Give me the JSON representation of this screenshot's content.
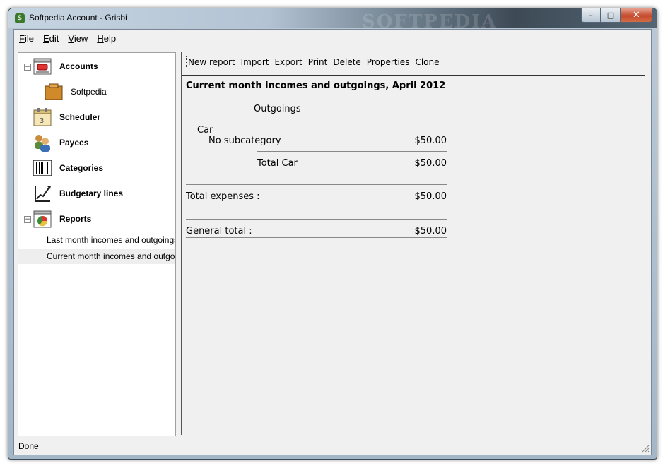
{
  "window": {
    "title": "Softpedia Account - Grisbi",
    "watermark": "SOFTPEDIA",
    "minimize_glyph": "–",
    "maximize_glyph": "□",
    "close_glyph": "✕"
  },
  "menubar": [
    {
      "hot": "F",
      "rest": "ile"
    },
    {
      "hot": "E",
      "rest": "dit"
    },
    {
      "hot": "V",
      "rest": "iew"
    },
    {
      "hot": "H",
      "rest": "elp"
    }
  ],
  "sidebar": {
    "accounts": {
      "label": "Accounts",
      "expander": "−",
      "icon": "accounts-icon"
    },
    "account_softpedia": {
      "label": "Softpedia",
      "icon": "account-folder-icon"
    },
    "scheduler": {
      "label": "Scheduler",
      "icon": "calendar-icon"
    },
    "payees": {
      "label": "Payees",
      "icon": "people-icon"
    },
    "categories": {
      "label": "Categories",
      "icon": "barcode-icon"
    },
    "budgetary": {
      "label": "Budgetary lines",
      "icon": "chart-icon"
    },
    "reports": {
      "label": "Reports",
      "expander": "−",
      "icon": "pie-report-icon"
    },
    "report_items": [
      {
        "label": "Last month incomes and outgoings"
      },
      {
        "label": "Current month incomes and outgoings"
      }
    ]
  },
  "toolbar": {
    "new_report": "New report",
    "import": "Import",
    "export": "Export",
    "print": "Print",
    "delete": "Delete",
    "properties": "Properties",
    "clone": "Clone"
  },
  "report": {
    "title": "Current month incomes and outgoings, April 2012",
    "section": "Outgoings",
    "category": "Car",
    "subcategory": "No subcategory",
    "subcategory_amount": "$50.00",
    "total_category_label": "Total Car",
    "total_category_amount": "$50.00",
    "total_expenses_label": "Total expenses :",
    "total_expenses_amount": "$50.00",
    "general_total_label": "General total :",
    "general_total_amount": "$50.00"
  },
  "status": {
    "text": "Done"
  },
  "colors": {
    "close_button": "#c44a2c",
    "selection": "#eeeeee"
  }
}
